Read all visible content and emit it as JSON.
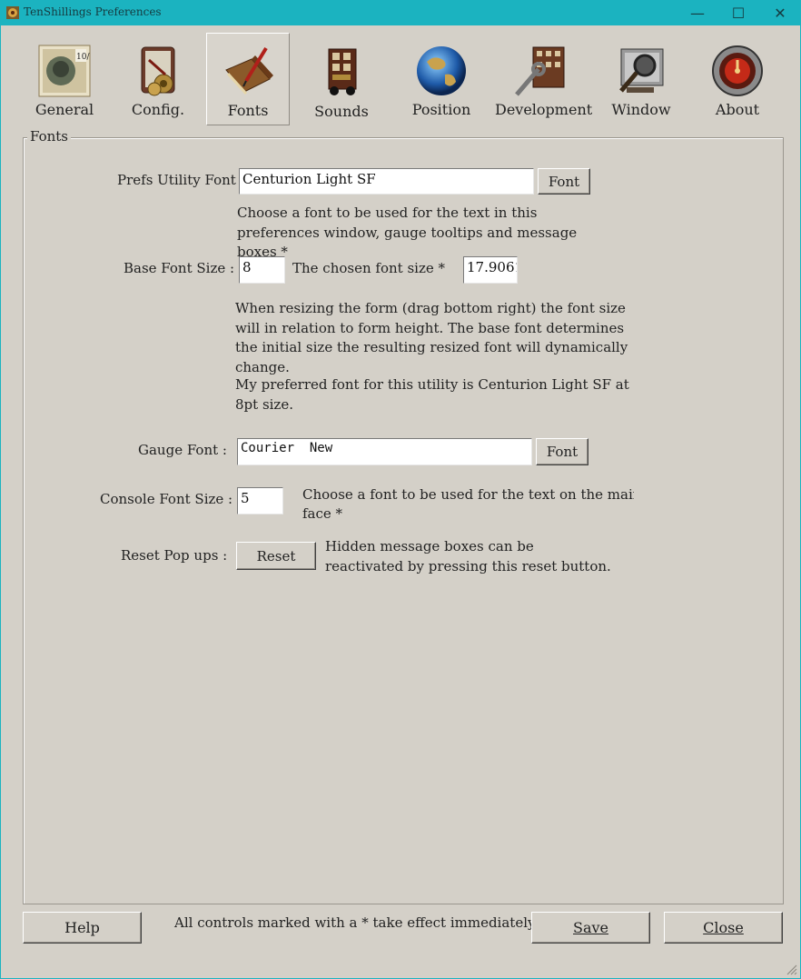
{
  "window": {
    "title": "TenShillings Preferences",
    "controls": {
      "minimize": "—",
      "maximize": "☐",
      "close": "✕"
    }
  },
  "toolbar": {
    "items": [
      {
        "label": "General",
        "icon": "stamp-icon"
      },
      {
        "label": "Config.",
        "icon": "config-icon"
      },
      {
        "label": "Fonts",
        "icon": "book-quill-icon",
        "selected": true
      },
      {
        "label": "Sounds",
        "icon": "sound-device-icon"
      },
      {
        "label": "Position",
        "icon": "globe-icon"
      },
      {
        "label": "Development",
        "icon": "development-icon"
      },
      {
        "label": "Window",
        "icon": "magnifier-window-icon"
      },
      {
        "label": "About",
        "icon": "about-gauge-icon"
      }
    ]
  },
  "fonts_group": {
    "title": "Fonts",
    "prefs_font_label": "Prefs Utility Font :",
    "prefs_font_value": "Centurion Light SF",
    "prefs_font_button": "Font",
    "prefs_font_help": "Choose a font to be used for the text in this preferences window, gauge tooltips and message boxes *",
    "base_size_label": "Base Font Size :",
    "base_size_value": "8",
    "chosen_size_label": "The chosen font size *",
    "chosen_size_value": "17.9061",
    "resize_help": "When resizing the form (drag bottom right) the font size will in relation to form height. The base font determines the initial size the resulting resized font will dynamically change.",
    "preferred_help": "My preferred font for this utility is Centurion Light SF at 8pt size.",
    "gauge_font_label": "Gauge Font :",
    "gauge_font_value": "Courier  New",
    "gauge_font_button": "Font",
    "console_size_label": "Console  Font Size :",
    "console_size_value": "5",
    "console_help_line1": "Choose a font to be used for the text on the main gau",
    "console_help_line2": "face *",
    "reset_label": "Reset Pop ups :",
    "reset_button": "Reset",
    "reset_help": "Hidden message boxes can be reactivated by pressing this reset button."
  },
  "footer": {
    "help_button": "Help",
    "note": "All controls marked with a * take effect immediately.",
    "save_button": "Save",
    "close_button": "Close"
  }
}
